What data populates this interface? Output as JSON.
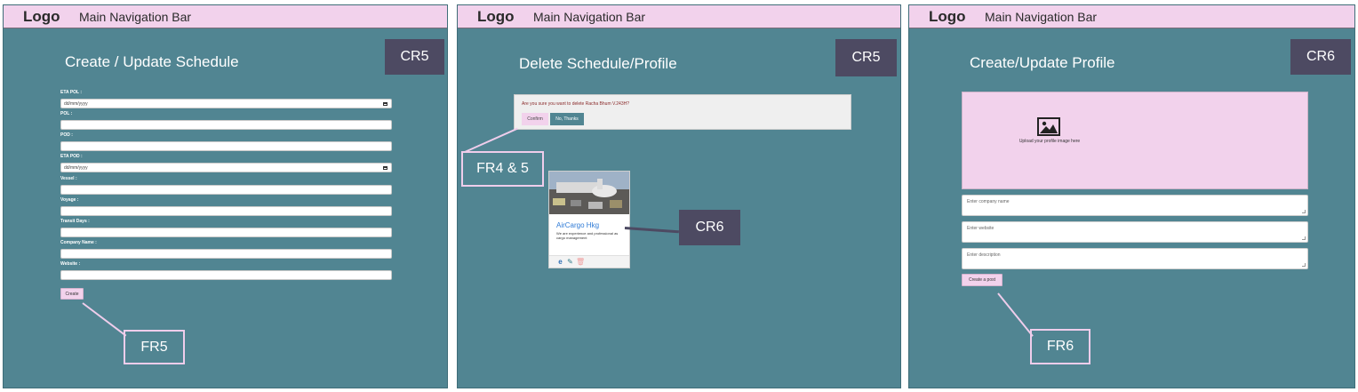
{
  "nav": {
    "logo": "Logo",
    "title": "Main Navigation Bar"
  },
  "panel1": {
    "title": "Create / Update Schedule",
    "tag": "CR5",
    "fields": [
      {
        "label": "ETA POL :",
        "value": "dd/mm/yyyy",
        "type": "date"
      },
      {
        "label": "POL :",
        "value": "",
        "type": "text"
      },
      {
        "label": "POD :",
        "value": "",
        "type": "text"
      },
      {
        "label": "ETA POD :",
        "value": "dd/mm/yyyy",
        "type": "date"
      },
      {
        "label": "Vessel :",
        "value": "",
        "type": "text"
      },
      {
        "label": "Voyage :",
        "value": "",
        "type": "text"
      },
      {
        "label": "Transit Days :",
        "value": "",
        "type": "text"
      },
      {
        "label": "Company Name :",
        "value": "",
        "type": "text"
      },
      {
        "label": "Website :",
        "value": "",
        "type": "text"
      }
    ],
    "button": "Create",
    "annotation": "FR5"
  },
  "panel2": {
    "title": "Delete Schedule/Profile",
    "tag": "CR5",
    "dialog_text": "Are you sure you want to delete Racha Bhum V.243H?",
    "confirm": "Confirm",
    "cancel": "No, Thanks",
    "annotation_dialog": "FR4 & 5",
    "card_title": "AirCargo Hkg",
    "card_desc": "We are experience and professional as cargo management",
    "annotation_card": "CR6"
  },
  "panel3": {
    "title": "Create/Update Profile",
    "tag": "CR6",
    "upload_text": "Upload your profile image here",
    "fields": [
      {
        "placeholder": "Enter company name"
      },
      {
        "placeholder": "Enter website"
      },
      {
        "placeholder": "Enter description"
      }
    ],
    "button": "Create a post",
    "annotation": "FR6"
  },
  "colors": {
    "panel_bg": "#518592",
    "nav_bg": "#f2d2ec",
    "tag_bg": "#4d4a62",
    "accent_pink": "#efcdeb",
    "link_blue": "#2f7bd6"
  },
  "icons": [
    "calendar-icon",
    "image-icon",
    "ie-icon",
    "edit-icon",
    "trash-icon"
  ]
}
